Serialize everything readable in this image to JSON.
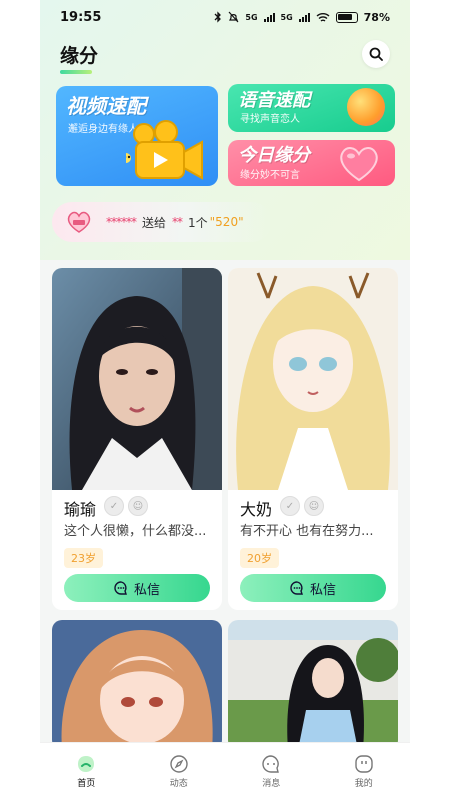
{
  "status_bar": {
    "time": "19:55",
    "network_1": "5G",
    "network_2": "5G",
    "battery": "78%"
  },
  "header": {
    "title": "缘分",
    "search_icon": "search-icon"
  },
  "banners": {
    "video": {
      "title": "视频速配",
      "subtitle": "邂逅身边有缘人"
    },
    "voice": {
      "title": "语音速配",
      "subtitle": "寻找声音恋人"
    },
    "fate": {
      "title": "今日缘分",
      "subtitle": "缘分妙不可言"
    }
  },
  "gift_notice": {
    "sender": "******",
    "verb": "送给",
    "receiver": "**",
    "count_prefix": "1个",
    "gift": "\"520\""
  },
  "cards": [
    {
      "name": "瑜瑜",
      "bio": "这个人很懒，什么都没...",
      "age": "23岁",
      "message_label": "私信"
    },
    {
      "name": "大奶",
      "bio": "有不开心 也有在努力...",
      "age": "20岁",
      "message_label": "私信"
    }
  ],
  "tabs": [
    {
      "label": "首页",
      "icon": "home-icon",
      "active": true
    },
    {
      "label": "动态",
      "icon": "compass-icon",
      "active": false
    },
    {
      "label": "消息",
      "icon": "chat-icon",
      "active": false
    },
    {
      "label": "我的",
      "icon": "profile-icon",
      "active": false
    }
  ],
  "colors": {
    "accent_green": "#36d78f",
    "video_blue": "#2f8ef5",
    "voice_green": "#17cc8e",
    "fate_pink": "#ff5a80",
    "age_orange": "#f0a030"
  }
}
